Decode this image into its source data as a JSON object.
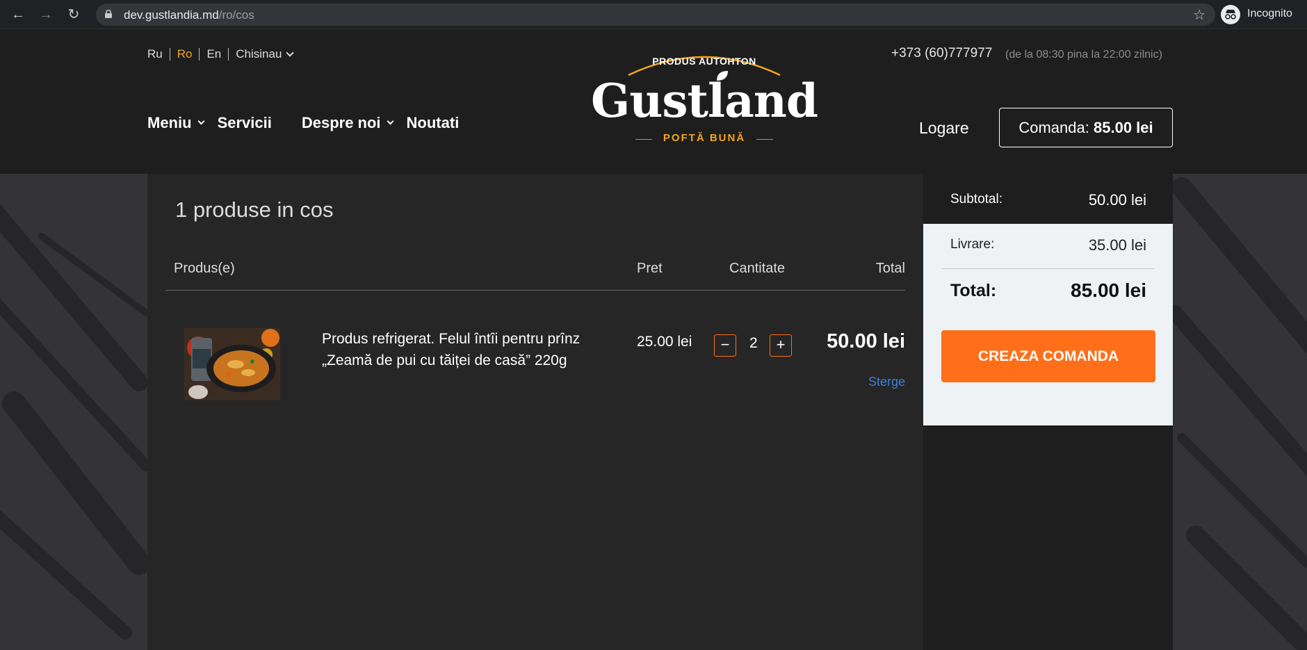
{
  "browser": {
    "url_host": "dev.gustlandia.md",
    "url_path": "/ro/cos",
    "incognito_label": "Incognito"
  },
  "header": {
    "languages": [
      "Ru",
      "Ro",
      "En"
    ],
    "active_language": "Ro",
    "city": "Chisinau",
    "phone": "+373 (60)777977",
    "hours": "(de la 08:30 pina la 22:00 zilnic)",
    "nav": [
      {
        "label": "Meniu",
        "has_dropdown": true
      },
      {
        "label": "Servicii",
        "has_dropdown": false
      },
      {
        "label": "Despre noi",
        "has_dropdown": true
      },
      {
        "label": "Noutati",
        "has_dropdown": false
      }
    ],
    "logo": {
      "arc_text": "PRODUS AUTOHTON",
      "word": "Gustland",
      "tagline": "POFTĂ BUNĂ"
    },
    "login_label": "Logare",
    "order_label": "Comanda:",
    "order_amount": "85.00 lei"
  },
  "cart": {
    "title": "1 produse in cos",
    "columns": [
      "Produs(e)",
      "Pret",
      "Cantitate",
      "Total"
    ],
    "items": [
      {
        "name": "Produs refrigerat. Felul întîi pentru prînz „Zeamă de pui cu tăiței de casă” 220g",
        "price": "25.00 lei",
        "quantity": "2",
        "total": "50.00 lei",
        "remove_label": "Sterge",
        "minus_label": "−",
        "plus_label": "+"
      }
    ]
  },
  "summary": {
    "subtotal_label": "Subtotal:",
    "subtotal_value": "50.00 lei",
    "delivery_label": "Livrare:",
    "delivery_value": "35.00 lei",
    "total_label": "Total:",
    "total_value": "85.00 lei",
    "create_order_label": "CREAZA COMANDA"
  },
  "colors": {
    "accent": "#f4a61b",
    "button": "#ff6f1a",
    "link": "#3e7fd6"
  }
}
